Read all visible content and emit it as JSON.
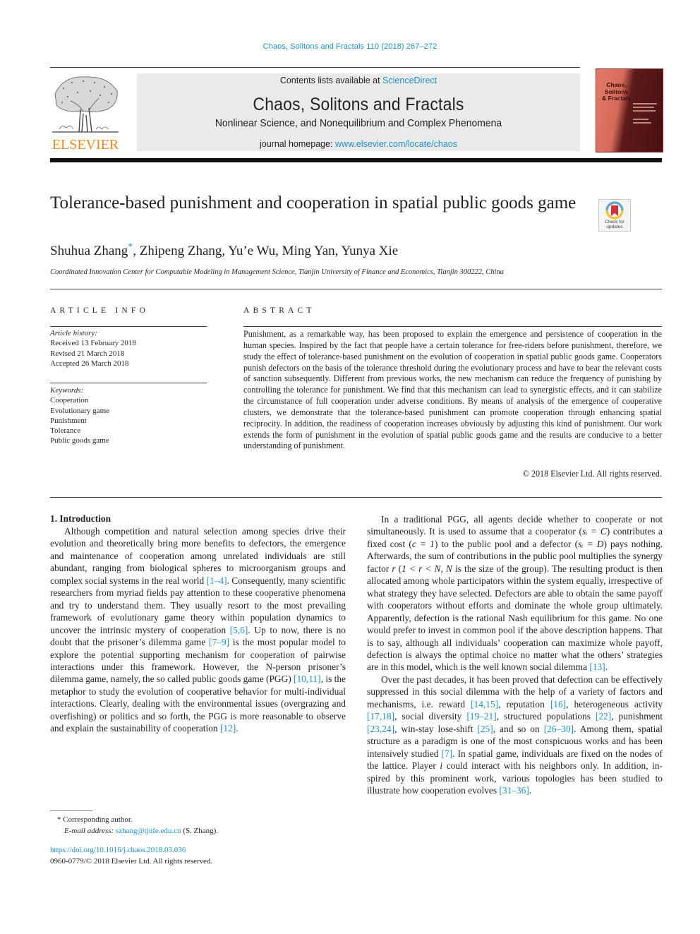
{
  "running_header": "Chaos, Solitons and Fractals 110 (2018) 267–272",
  "masthead": {
    "publisher_logo_text": "ELSEVIER",
    "contents_prefix": "Contents lists available at ",
    "contents_link": "ScienceDirect",
    "journal_title": "Chaos, Solitons and Fractals",
    "journal_subtitle": "Nonlinear Science, and Nonequilibrium and Complex Phenomena",
    "homepage_prefix": "journal homepage: ",
    "homepage_link": "www.elsevier.com/locate/chaos",
    "cover_title_lines": [
      "Chaos,",
      "Solitons",
      "& Fractals"
    ]
  },
  "article": {
    "title": "Tolerance-based punishment and cooperation in spatial public goods game",
    "crossmark_label": "Check for updates",
    "authors": [
      {
        "name": "Shuhua Zhang",
        "mark": "*"
      },
      {
        "name": "Zhipeng Zhang"
      },
      {
        "name": "Yu’e Wu"
      },
      {
        "name": "Ming Yan"
      },
      {
        "name": "Yunya Xie"
      }
    ],
    "affiliation": "Coordinated Innovation Center for Computable Modeling in Management Science, Tianjin University of Finance and Economics, Tianjin 300222, China"
  },
  "article_info": {
    "heading": "ARTICLE INFO",
    "history_label": "Article history:",
    "history": [
      "Received 13 February 2018",
      "Revised 21 March 2018",
      "Accepted 26 March 2018"
    ],
    "keywords_label": "Keywords:",
    "keywords": [
      "Cooperation",
      "Evolutionary game",
      "Punishment",
      "Tolerance",
      "Public goods game"
    ]
  },
  "abstract": {
    "heading": "ABSTRACT",
    "text": "Punishment, as a remarkable way, has been proposed to explain the emergence and persistence of co­operation in the human species. Inspired by the fact that people have a certain tolerance for free-riders before punishment, therefore, we study the effect of tolerance-based punishment on the evolution of cooperation in spatial public goods game. Cooperators punish defectors on the basis of the tolerance threshold during the evolutionary process and have to bear the relevant costs of sanction subsequently. Different from previous works, the new mechanism can reduce the frequency of punishing by control­ling the tolerance for punishment. We find that this mechanism can lead to synergistic effects, and it can stabilize the circumstance of full cooperation under adverse conditions. By means of analysis of the emergence of cooperative clusters, we demonstrate that the tolerance-based punishment can promote cooperation through enhancing spatial reciprocity. In addition, the readiness of cooperation increases ob­viously by adjusting this kind of punishment. Our work extends the form of punishment in the evolution of spatial public goods game and the results are conducive to a better understanding of punishment.",
    "copyright": "© 2018 Elsevier Ltd. All rights reserved."
  },
  "introduction": {
    "heading": "1. Introduction",
    "left_paragraph": [
      {
        "t": "Although competition and natural selection among species drive their evolution and theoretically bring more benefits to de­fectors, the emergence and maintenance of cooperation among unrelated individuals are still abundant, ranging from biological spheres to microorganism groups and complex social systems in the real world "
      },
      {
        "ref": "[1–4]"
      },
      {
        "t": ". Consequently, many scientific researchers from myriad fields pay attention to these cooperative phenom­ena and try to understand them. They usually resort to the most prevailing framework of evolutionary game theory within popu­lation dynamics to uncover the intrinsic mystery of cooperation "
      },
      {
        "ref": "[5,6]"
      },
      {
        "t": ". Up to now, there is no doubt that the prisoner’s dilemma game "
      },
      {
        "ref": "[7–9]"
      },
      {
        "t": " is the most popular model to explore the potential supporting mechanism for cooperation of pairwise interactions un­der this framework. However, the N-person prisoner’s dilemma game, namely, the so called public goods game (PGG) "
      },
      {
        "ref": "[10,11]"
      },
      {
        "t": ", is the metaphor to study the evolution of cooperative behavior for multi-individual interactions. Clearly, dealing with the environmental is­sues (overgrazing and overfishing) or politics and so forth, the PGG is more reasonable to observe and explain the sustainability of co­operation "
      },
      {
        "ref": "[12]"
      },
      {
        "t": "."
      }
    ],
    "right_paragraph_1": [
      {
        "t": "In a traditional PGG, all agents decide whether to cooperate or not simultaneously. It is used to assume that a cooperator ("
      },
      {
        "m": "sᵢ = C"
      },
      {
        "t": ") contributes a fixed cost ("
      },
      {
        "m": "c = 1"
      },
      {
        "t": ") to the public pool and a defec­tor ("
      },
      {
        "m": "sᵢ = D"
      },
      {
        "t": ") pays nothing. Afterwards, the sum of contributions in the public pool multiplies the synergy factor "
      },
      {
        "m": "r"
      },
      {
        "t": " ("
      },
      {
        "m": "1 < r < N, N"
      },
      {
        "t": " is the size of the group). The resulting product is then allocated among whole participators within the system equally, irrespective of what strategy they have selected. Defectors are able to obtain the same payoff with cooperators without efforts and dominate the whole group ultimately. Apparently, defection is the rational Nash equi­librium for this game. No one would prefer to invest in common pool if the above description happens. That is to say, although all individuals’ cooperation can maximize whole payoff, defection is always the optimal choice no matter what the others’ strategies are in this model, which is the well known social dilemma "
      },
      {
        "ref": "[13]"
      },
      {
        "t": "."
      }
    ],
    "right_paragraph_2": [
      {
        "t": "Over the past decades, it has been proved that defection can be effectively suppressed in this social dilemma with the help of a va­riety of factors and mechanisms, i.e. reward "
      },
      {
        "ref": "[14,15]"
      },
      {
        "t": ", reputation "
      },
      {
        "ref": "[16]"
      },
      {
        "t": ", heterogeneous activity "
      },
      {
        "ref": "[17,18]"
      },
      {
        "t": ", social diversity "
      },
      {
        "ref": "[19–21]"
      },
      {
        "t": ", structured populations "
      },
      {
        "ref": "[22]"
      },
      {
        "t": ", punishment "
      },
      {
        "ref": "[23,24]"
      },
      {
        "t": ", win-stay lose-shift "
      },
      {
        "ref": "[25]"
      },
      {
        "t": ", and so on "
      },
      {
        "ref": "[26–30]"
      },
      {
        "t": ". Among them, spatial structure as a paradigm is one of the most conspicuous works and has been intensively studied "
      },
      {
        "ref": "[7]"
      },
      {
        "t": ". In spatial game, individuals are fixed on the nodes of the lat­tice. Player "
      },
      {
        "m": "i"
      },
      {
        "t": " could interact with his neighbors only. In addition, in­spired by this prominent work, various topologies has been studied to illustrate how cooperation evolves "
      },
      {
        "ref": "[31–36]"
      },
      {
        "t": "."
      }
    ]
  },
  "footnotes": {
    "mark": "*",
    "corresponding": "Corresponding author.",
    "email_label": "E-mail address:",
    "email": "szhang@tjufe.edu.cn",
    "email_suffix": " (S. Zhang).",
    "doi": "https://doi.org/10.1016/j.chaos.2018.03.036",
    "issn_line": "0960-0779/© 2018 Elsevier Ltd. All rights reserved."
  },
  "colors": {
    "link": "#1f8fbf",
    "publisher_orange": "#f08a1d",
    "masthead_bg": "#eaeaea",
    "text": "#231f20"
  }
}
